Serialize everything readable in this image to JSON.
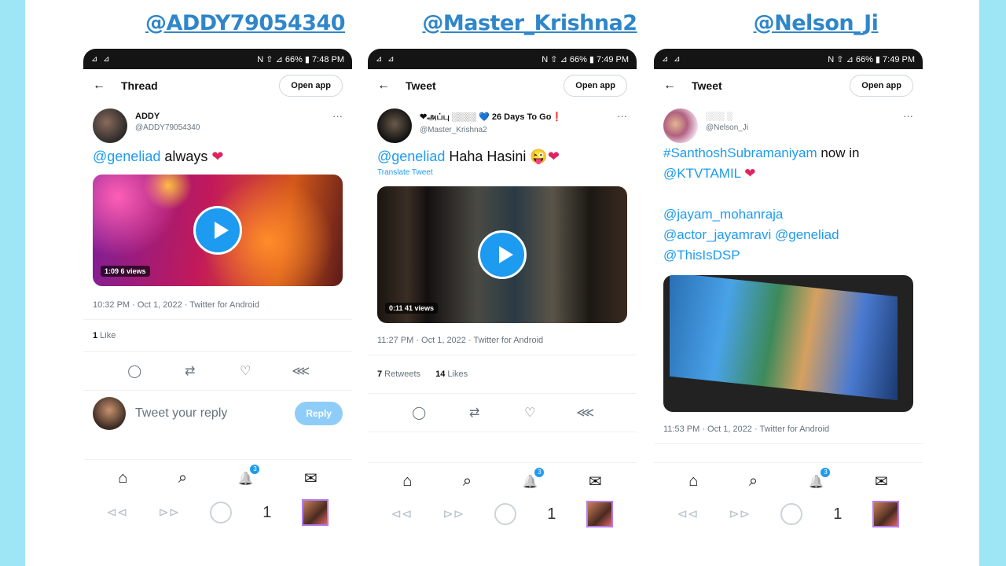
{
  "captions": [
    "@ADDY79054340",
    "@Master_Krishna2",
    "@Nelson_Ji"
  ],
  "phones": [
    {
      "status_left": "⊿ ⊿",
      "status_right": "N ⇧ ⊿ 66% ▮ 7:48 PM",
      "page_title": "Thread",
      "open_app": "Open app",
      "display_name": "ADDY",
      "handle": "@ADDY79054340",
      "text_mention": "@geneliad",
      "text_body": " always ",
      "heart": "❤",
      "video_badge": "1:09  6 views",
      "meta": "10:32 PM · Oct 1, 2022 · Twitter for Android",
      "stats_count": "1",
      "stats_label": " Like",
      "reply_placeholder": "Tweet your reply",
      "reply_button": "Reply",
      "notif_count": "3",
      "sys_number": "1"
    },
    {
      "status_left": "⊿ ⊿",
      "status_right": "N ⇧ ⊿ 66% ▮ 7:49 PM",
      "page_title": "Tweet",
      "open_app": "Open app",
      "display_name": "❤அப்பு ░░░░ 💙 26 Days To Go❗",
      "handle": "@Master_Krishna2",
      "text_mention": "@geneliad",
      "text_body": " Haha Hasini 😜",
      "heart": "❤",
      "translate": "Translate Tweet",
      "video_badge": "0:11  41 views",
      "meta": "11:27 PM · Oct 1, 2022 · Twitter for Android",
      "retweets_count": "7",
      "retweets_label": " Retweets",
      "likes_count": "14",
      "likes_label": " Likes",
      "notif_count": "3",
      "sys_number": "1"
    },
    {
      "status_left": "⊿ ⊿",
      "status_right": "N ⇧ ⊿ 66% ▮ 7:49 PM",
      "page_title": "Tweet",
      "open_app": "Open app",
      "display_name": "░░░ ░",
      "handle": "@Nelson_Ji",
      "line1_link": "#SanthoshSubramaniyam",
      "line1_text": " now in",
      "line2_link": "@KTVTAMIL",
      "heart": "❤",
      "mentions": [
        "@jayam_mohanraja",
        "@actor_jayamravi",
        "@geneliad",
        "@ThisIsDSP"
      ],
      "meta": "11:53 PM · Oct 1, 2022 · Twitter for Android",
      "notif_count": "3",
      "sys_number": "1"
    }
  ],
  "icons": {
    "back": "←",
    "more": "···",
    "reply": "◯",
    "retweet": "⇄",
    "like": "♡",
    "share": "⋘",
    "home": "⌂",
    "search": "⌕",
    "bell": "🔔",
    "mail": "✉",
    "sys_back": "⊲⊲",
    "sys_forward": "⊳⊳"
  },
  "colors": {
    "accent": "#1d9bf0",
    "caption": "#2f86c8",
    "heart": "#e0245e",
    "frame": "#9ee6f6"
  }
}
